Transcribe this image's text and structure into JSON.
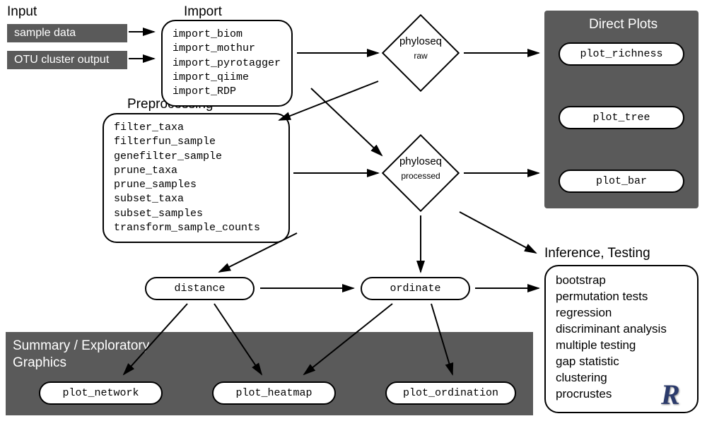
{
  "headings": {
    "input": "Input",
    "import": "Import",
    "preprocessing": "Preprocessing",
    "direct_plots": "Direct Plots",
    "summary": "Summary / Exploratory\nGraphics",
    "inference": "Inference, Testing"
  },
  "input": {
    "sample": "sample data",
    "otu": "OTU cluster output"
  },
  "import_funcs": "import_biom\nimport_mothur\nimport_pyrotagger\nimport_qiime\nimport_RDP",
  "preprocess_funcs": "filter_taxa\nfilterfun_sample\ngenefilter_sample\nprune_taxa\nprune_samples\nsubset_taxa\nsubset_samples\ntransform_sample_counts",
  "diamond": {
    "raw_t": "phyloseq",
    "raw_s": "raw",
    "proc_t": "phyloseq",
    "proc_s": "processed"
  },
  "pills": {
    "richness": "plot_richness",
    "tree": "plot_tree",
    "bar": "plot_bar",
    "distance": "distance",
    "ordinate": "ordinate",
    "network": "plot_network",
    "heatmap": "plot_heatmap",
    "ordination": "plot_ordination"
  },
  "inference_list": "bootstrap\npermutation tests\nregression\ndiscriminant analysis\nmultiple testing\ngap statistic\nclustering\nprocrustes",
  "logo": "R"
}
